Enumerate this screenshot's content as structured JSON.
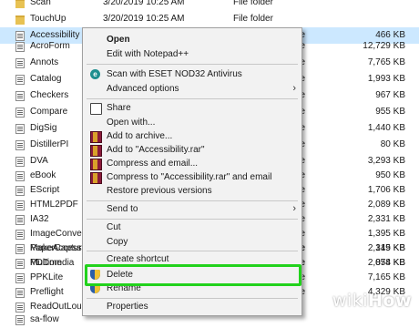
{
  "file_list": [
    {
      "name": "Scan",
      "date": "3/20/2019 10:25 AM",
      "type": "File folder",
      "size": "",
      "kind": "folder"
    },
    {
      "name": "TouchUp",
      "date": "3/20/2019 10:25 AM",
      "type": "File folder",
      "size": "",
      "kind": "folder"
    },
    {
      "name": "Accessibility",
      "date": "",
      "type": "ile",
      "size": "466 KB",
      "kind": "file",
      "selected": true
    },
    {
      "name": "AcroForm",
      "date": "",
      "type": "ile",
      "size": "12,729 KB",
      "kind": "file"
    },
    {
      "name": "Annots",
      "date": "",
      "type": "ile",
      "size": "7,765 KB",
      "kind": "file"
    },
    {
      "name": "Catalog",
      "date": "",
      "type": "ile",
      "size": "1,993 KB",
      "kind": "file"
    },
    {
      "name": "Checkers",
      "date": "",
      "type": "ile",
      "size": "967 KB",
      "kind": "file"
    },
    {
      "name": "Compare",
      "date": "",
      "type": "ile",
      "size": "955 KB",
      "kind": "file"
    },
    {
      "name": "DigSig",
      "date": "",
      "type": "ile",
      "size": "1,440 KB",
      "kind": "file"
    },
    {
      "name": "DistillerPI",
      "date": "",
      "type": "ile",
      "size": "80 KB",
      "kind": "file"
    },
    {
      "name": "DVA",
      "date": "",
      "type": "ile",
      "size": "3,293 KB",
      "kind": "file"
    },
    {
      "name": "eBook",
      "date": "",
      "type": "ile",
      "size": "950 KB",
      "kind": "file"
    },
    {
      "name": "EScript",
      "date": "",
      "type": "ile",
      "size": "1,706 KB",
      "kind": "file"
    },
    {
      "name": "HTML2PDF",
      "date": "",
      "type": "ile",
      "size": "2,089 KB",
      "kind": "file"
    },
    {
      "name": "IA32",
      "date": "",
      "type": "ile",
      "size": "2,331 KB",
      "kind": "file"
    },
    {
      "name": "ImageConversi",
      "date": "",
      "type": "ile",
      "size": "1,395 KB",
      "kind": "file"
    },
    {
      "name": "MakeAccessibl",
      "date": "",
      "type": "ile",
      "size": "315 KB",
      "kind": "file"
    },
    {
      "name": "Multimedia",
      "date": "",
      "type": "ile",
      "size": "2,074 KB",
      "kind": "file"
    },
    {
      "name": "PaperCapture",
      "date": "",
      "type": "ile",
      "size": "2,149 KB",
      "kind": "file"
    },
    {
      "name": "PDDom",
      "date": "",
      "type": "ile",
      "size": "858 KB",
      "kind": "file"
    },
    {
      "name": "PPKLite",
      "date": "",
      "type": "ile",
      "size": "7,165 KB",
      "kind": "file"
    },
    {
      "name": "Preflight",
      "date": "",
      "type": "ile",
      "size": "4,329 KB",
      "kind": "file"
    },
    {
      "name": "ReadOutLoud",
      "date": "",
      "type": "",
      "size": "",
      "kind": "file"
    },
    {
      "name": "sa-flow",
      "date": "",
      "type": "",
      "size": "",
      "kind": "file"
    }
  ],
  "context_menu": {
    "items": [
      {
        "label": "Open",
        "bold": true,
        "icon": ""
      },
      {
        "label": "Edit with Notepad++",
        "icon": ""
      },
      {
        "label": "Scan with ESET NOD32 Antivirus",
        "icon": "eset-icon",
        "icon_text": "e"
      },
      {
        "label": "Advanced options",
        "icon": "",
        "submenu": true
      },
      {
        "label": "Share",
        "icon": "share-icon"
      },
      {
        "label": "Open with...",
        "icon": ""
      },
      {
        "label": "Add to archive...",
        "icon": "winrar-icon"
      },
      {
        "label": "Add to \"Accessibility.rar\"",
        "icon": "winrar-icon"
      },
      {
        "label": "Compress and email...",
        "icon": "winrar-icon"
      },
      {
        "label": "Compress to \"Accessibility.rar\" and email",
        "icon": "winrar-icon"
      },
      {
        "label": "Restore previous versions",
        "icon": ""
      },
      {
        "label": "Send to",
        "icon": "",
        "submenu": true
      },
      {
        "label": "Cut",
        "icon": ""
      },
      {
        "label": "Copy",
        "icon": ""
      },
      {
        "label": "Create shortcut",
        "icon": ""
      },
      {
        "label": "Delete",
        "icon": "shield-icon",
        "highlighted": true
      },
      {
        "label": "Rename",
        "icon": "shield-icon"
      },
      {
        "label": "Properties",
        "icon": ""
      }
    ],
    "submenu_arrow": "›"
  },
  "watermark": {
    "wiki": "wiki",
    "how": "How"
  },
  "colors": {
    "selection": "#cce8ff",
    "highlight": "#22d21c",
    "menu_bg": "#f2f2f2"
  }
}
